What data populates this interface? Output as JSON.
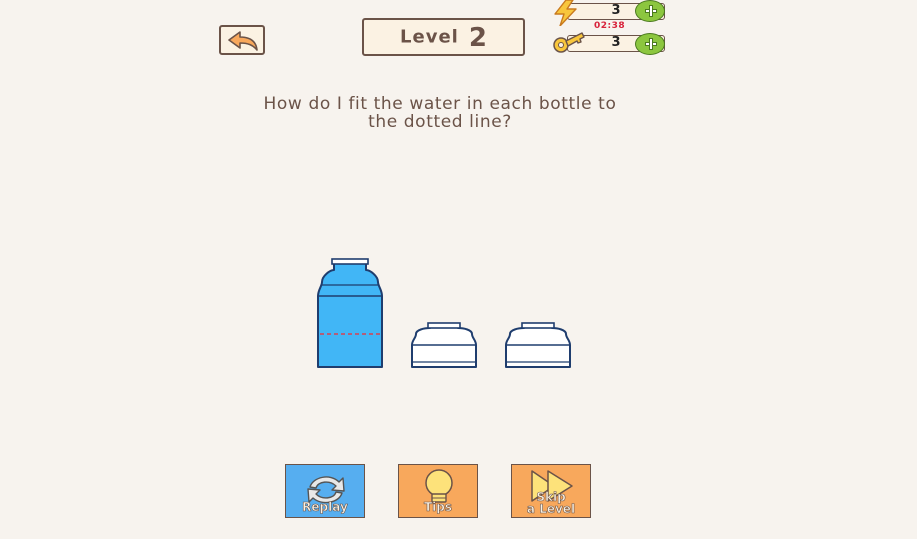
{
  "header": {
    "level_label": "Level",
    "level_number": "2"
  },
  "resources": {
    "energy_count": "3",
    "key_count": "3",
    "energy_timer": "02:38"
  },
  "question": {
    "line1": "How do I fit the water in each bottle to",
    "line2": "the dotted line?"
  },
  "puzzle": {
    "water_color": "#41b6f6",
    "dotted_line_color": "#d84050",
    "bottle_outline": "#1f3d6e",
    "bottles": [
      {
        "kind": "tall",
        "filled": true
      },
      {
        "kind": "short",
        "filled": false
      },
      {
        "kind": "short",
        "filled": false
      }
    ]
  },
  "actions": {
    "replay_label": "Replay",
    "tips_label": "Tips",
    "skip_label_1": "Skip",
    "skip_label_2": "a Level"
  },
  "colors": {
    "background": "#f7f3ee",
    "panel": "#fbf2e3",
    "border": "#6b5348",
    "plus": "#8cc63f",
    "replay": "#56aef0",
    "orange": "#f8a85c"
  }
}
